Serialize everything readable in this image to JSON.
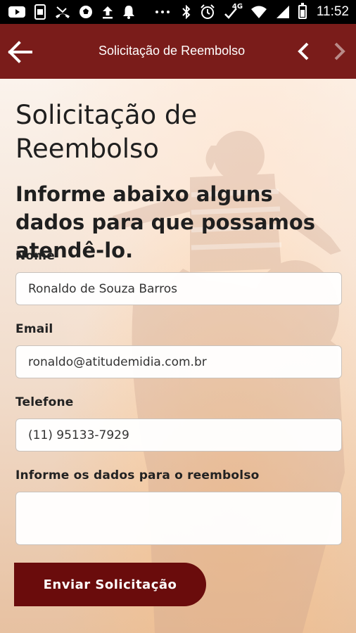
{
  "status_bar": {
    "time": "11:52",
    "left_icons": [
      "youtube-icon",
      "screenshot-icon",
      "missed-call-icon",
      "soccer-icon",
      "upload-icon",
      "notification-bell-icon",
      "more-dots-icon"
    ],
    "right_icons": [
      "bluetooth-icon",
      "alarm-icon",
      "signal-4g-icon",
      "wifi-icon",
      "cell-signal-icon",
      "battery-icon"
    ],
    "network": "4G"
  },
  "app_bar": {
    "title": "Solicitação de Reembolso",
    "color": "#7a1c1a"
  },
  "main": {
    "title": "Solicitação de Reembolso",
    "subtitle": "Informe abaixo alguns dados para que possamos atendê-lo."
  },
  "form": {
    "name": {
      "label": "Nome",
      "value": "Ronaldo de Souza Barros"
    },
    "email": {
      "label": "Email",
      "value": "ronaldo@atitudemidia.com.br"
    },
    "phone": {
      "label": "Telefone",
      "value": "(11) 95133-7929"
    },
    "details": {
      "label": "Informe os dados para o reembolso",
      "value": ""
    },
    "submit_label": "Enviar Solicitação",
    "submit_color": "#6a0c0c"
  }
}
